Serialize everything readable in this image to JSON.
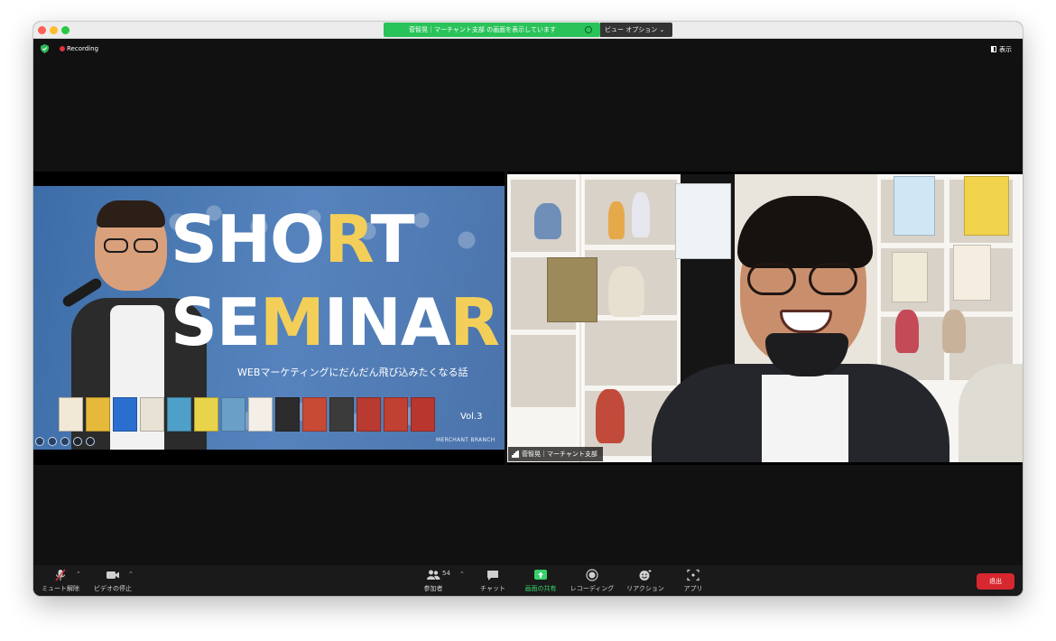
{
  "window": {
    "share_banner": "菅智晃｜マーチャント支部 の画面を表示しています",
    "view_options": "ビュー オプション ⌄"
  },
  "topbar": {
    "recording_label": "Recording",
    "view_label": "表示"
  },
  "shared_slide": {
    "title_line1": [
      "SHO",
      "R",
      "T"
    ],
    "title_line2": [
      "SE",
      "M",
      "INA",
      "R"
    ],
    "subtitle": "WEBマーケティングにだんだん飛び込みたくなる話",
    "volume": "Vol.3",
    "footer": "MERCHANT BRANCH",
    "accent_color": "#f3cf59",
    "background_color": "#4b7ab3"
  },
  "participant_video": {
    "name": "菅智晃｜マーチャント支部"
  },
  "toolbar": {
    "mute": "ミュート解除",
    "video": "ビデオの停止",
    "participants": "参加者",
    "participants_count": "54",
    "chat": "チャット",
    "share": "画面の共有",
    "recording": "レコーディング",
    "reactions": "リアクション",
    "apps": "アプリ",
    "leave": "退出",
    "share_color": "#35d46b",
    "leave_color": "#d7272f"
  }
}
